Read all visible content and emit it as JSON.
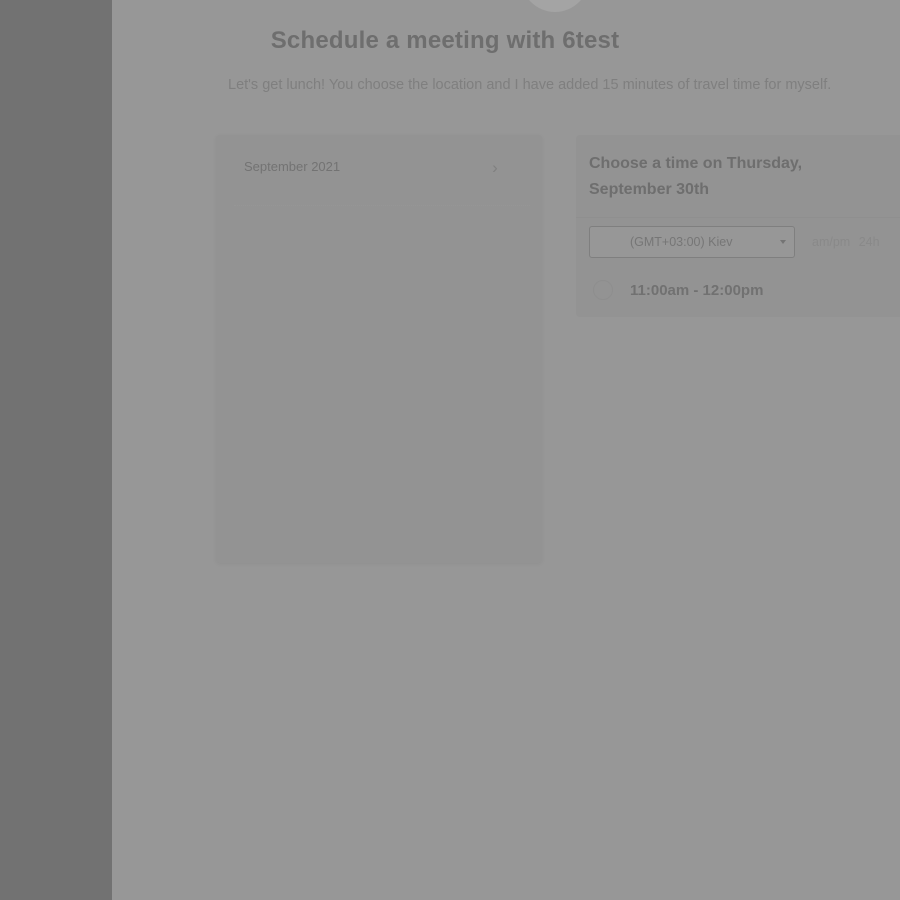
{
  "header": {
    "title": "Schedule a meeting with 6test",
    "subtitle": "Let's get lunch! You choose the location and I have added 15 minutes of travel time for myself."
  },
  "calendar": {
    "month_label": "September 2021",
    "next_icon": "chevron-right-icon"
  },
  "times": {
    "heading": "Choose a time on Thursday, September 30th",
    "timezone": {
      "selected": "(GMT+03:00) Kiev"
    },
    "format_options": [
      "am/pm",
      "24h"
    ],
    "slots": [
      {
        "label": "11:00am - 12:00pm"
      }
    ]
  },
  "colors": {
    "overlay_gray": "#979797",
    "sidebar_gray": "#727272"
  }
}
